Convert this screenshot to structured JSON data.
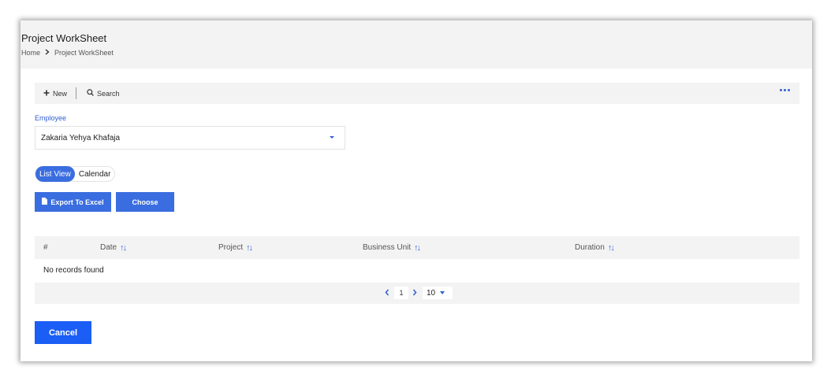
{
  "header": {
    "title": "Project WorkSheet",
    "breadcrumb": {
      "home": "Home",
      "current": "Project WorkSheet"
    }
  },
  "toolbar": {
    "new_label": "New",
    "search_label": "Search",
    "new_icon": "plus-icon",
    "search_icon": "search-icon",
    "more_icon": "more-horizontal-icon"
  },
  "employee": {
    "label": "Employee",
    "selected": "Zakaria Yehya Khafaja"
  },
  "view_toggle": {
    "list": "List View",
    "calendar": "Calendar",
    "active": "List View"
  },
  "actions": {
    "export_label": "Export To Excel",
    "choose_label": "Choose"
  },
  "grid": {
    "columns": [
      "#",
      "Date",
      "Project",
      "Business Unit",
      "Duration"
    ],
    "empty_text": "No records found"
  },
  "pager": {
    "current_page": "1",
    "page_size": "10"
  },
  "footer": {
    "cancel_label": "Cancel"
  },
  "colors": {
    "accent": "#3a6de0",
    "cancel": "#1b5ef5",
    "panel": "#f3f3f3"
  }
}
